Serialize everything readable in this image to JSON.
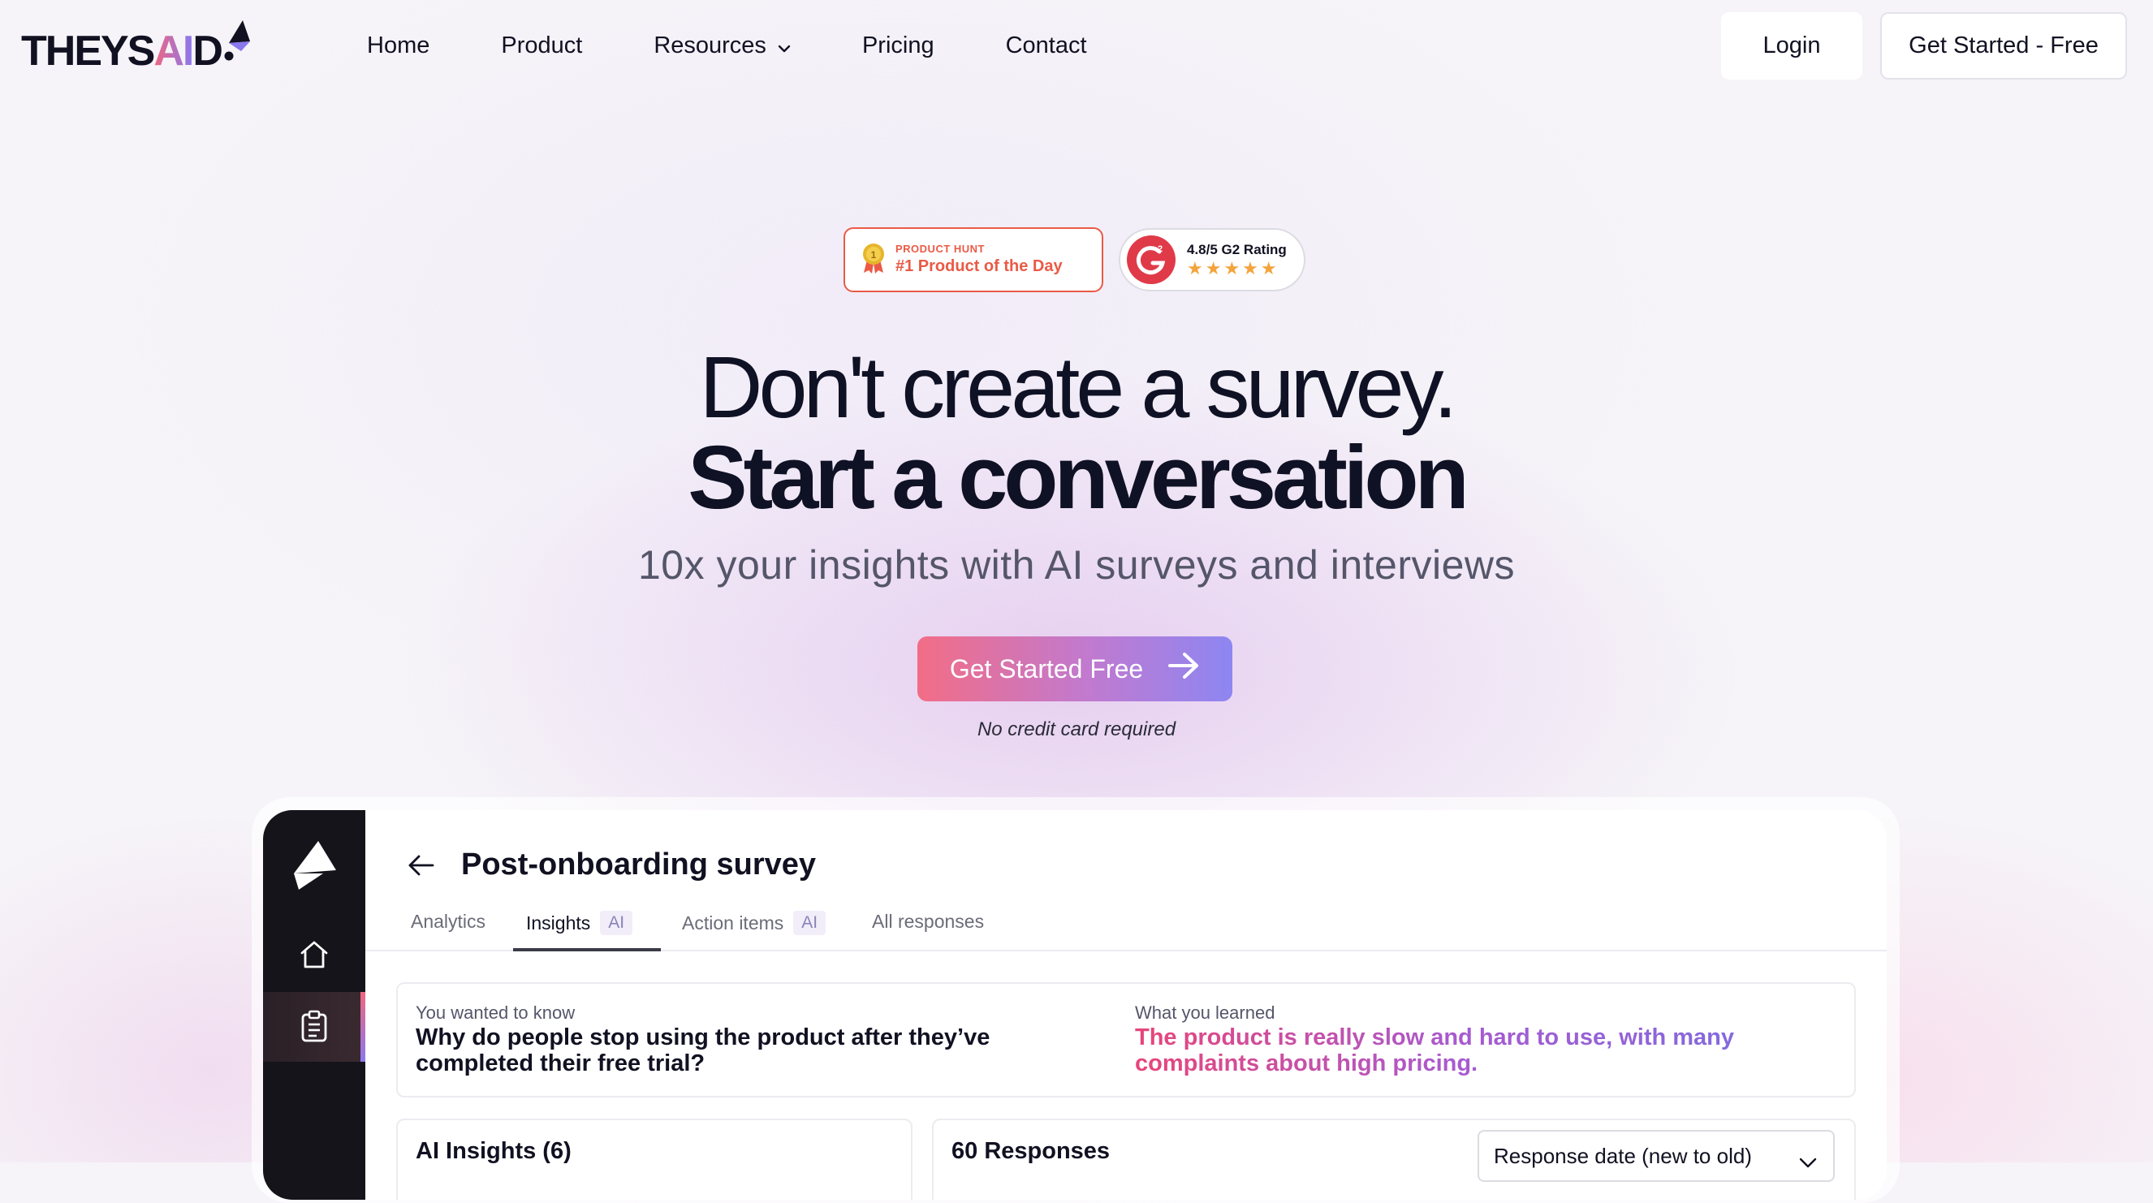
{
  "brand": {
    "name_part1": "THEYS",
    "name_part2": "AI",
    "name_part3": "D",
    "accent_pink": "#f06680",
    "accent_purple": "#8b78ee"
  },
  "nav": {
    "items": [
      {
        "label": "Home"
      },
      {
        "label": "Product"
      },
      {
        "label": "Resources",
        "has_dropdown": true
      },
      {
        "label": "Pricing"
      },
      {
        "label": "Contact"
      }
    ],
    "login_label": "Login",
    "get_started_label": "Get Started - Free"
  },
  "badges": {
    "product_hunt": {
      "small": "PRODUCT HUNT",
      "big": "#1 Product of the Day",
      "color": "#ea5a46"
    },
    "g2": {
      "rating": "4.8/5 G2 Rating",
      "stars": "★★★★★",
      "stars_value": 5
    }
  },
  "hero": {
    "line1": "Don't create a survey.",
    "line2": "Start a conversation",
    "subtitle": "10x your insights with AI surveys and interviews",
    "cta_label": "Get Started Free",
    "cta_note": "No credit card required"
  },
  "app_preview": {
    "title": "Post-onboarding survey",
    "tabs": [
      {
        "label": "Analytics"
      },
      {
        "label": "Insights",
        "pill": "AI",
        "active": true
      },
      {
        "label": "Action items",
        "pill": "AI"
      },
      {
        "label": "All responses"
      }
    ],
    "insight": {
      "question_label": "You wanted to know",
      "question": "Why do people stop using the product after they’ve completed their free trial?",
      "answer_label": "What you learned",
      "answer": "The product is really slow and hard to use, with many complaints about high pricing."
    },
    "ai_insights_title": "AI Insights (6)",
    "responses_title": "60 Responses",
    "sort_value": "Response date (new to old)"
  }
}
